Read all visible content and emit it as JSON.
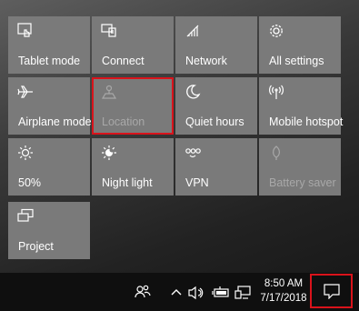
{
  "action_center": {
    "tiles": [
      {
        "label": "Tablet mode",
        "icon": "tablet-mode-icon",
        "enabled": true
      },
      {
        "label": "Connect",
        "icon": "connect-icon",
        "enabled": true
      },
      {
        "label": "Network",
        "icon": "network-icon",
        "enabled": true
      },
      {
        "label": "All settings",
        "icon": "gear-icon",
        "enabled": true
      },
      {
        "label": "Airplane mode",
        "icon": "airplane-icon",
        "enabled": true
      },
      {
        "label": "Location",
        "icon": "location-icon",
        "enabled": false,
        "highlighted": true
      },
      {
        "label": "Quiet hours",
        "icon": "moon-icon",
        "enabled": true
      },
      {
        "label": "Mobile hotspot",
        "icon": "hotspot-icon",
        "enabled": true
      },
      {
        "label": "50%",
        "icon": "brightness-icon",
        "enabled": true
      },
      {
        "label": "Night light",
        "icon": "night-light-icon",
        "enabled": true
      },
      {
        "label": "VPN",
        "icon": "vpn-icon",
        "enabled": true
      },
      {
        "label": "Battery saver",
        "icon": "battery-saver-icon",
        "enabled": false
      },
      {
        "label": "Project",
        "icon": "project-icon",
        "enabled": true
      }
    ]
  },
  "taskbar": {
    "time": "8:50 AM",
    "date": "7/17/2018",
    "icons": [
      "people-icon",
      "chevron-up-icon",
      "volume-icon",
      "battery-icon",
      "network-wired-icon",
      "action-center-icon"
    ]
  },
  "colors": {
    "tile": "#7a7a7a",
    "highlight": "#d9131b",
    "taskbar": "#0f0f0f"
  }
}
